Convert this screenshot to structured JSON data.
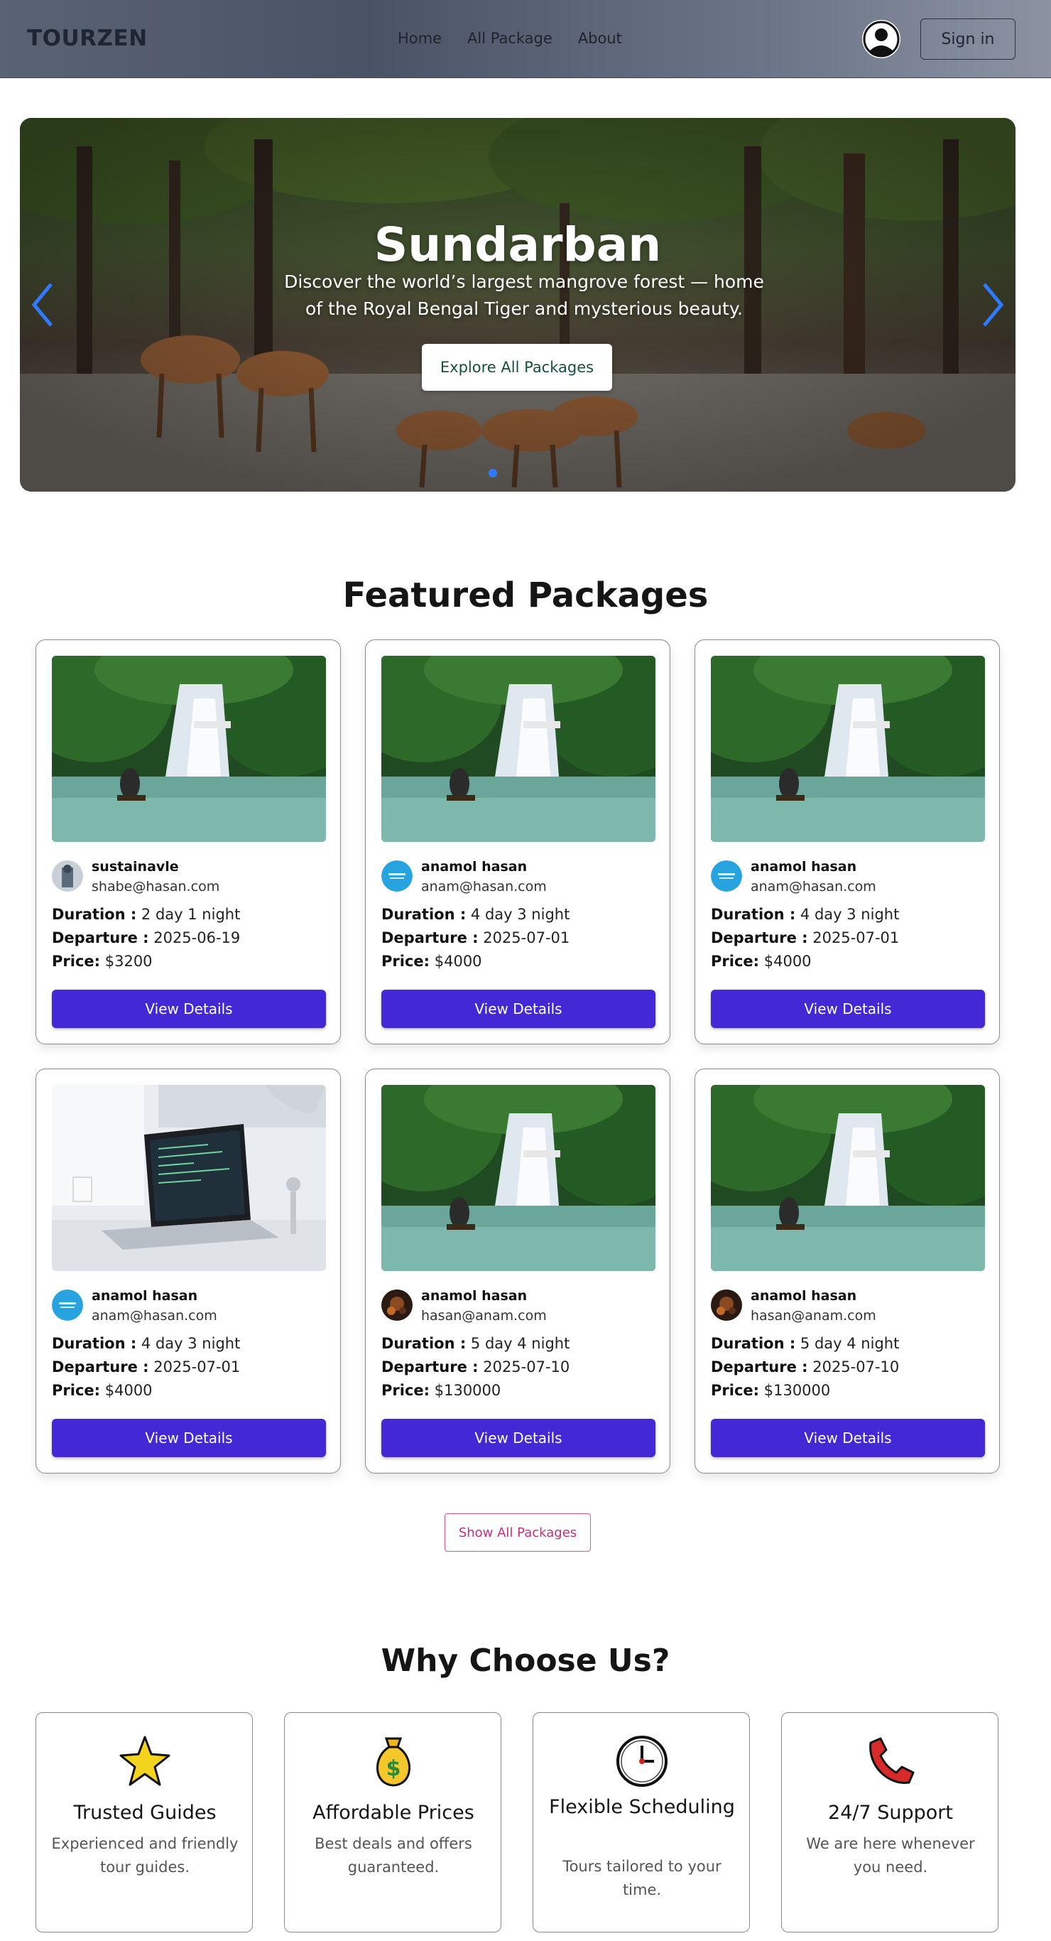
{
  "nav": {
    "brand": "TOURZEN",
    "links": [
      "Home",
      "All Package",
      "About"
    ],
    "signin": "Sign in"
  },
  "hero": {
    "title": "Sundarban",
    "subtitle": "Discover the world’s largest mangrove forest — home of the Royal Bengal Tiger and mysterious beauty.",
    "button": "Explore All Packages"
  },
  "featured": {
    "title": "Featured Packages",
    "cards": [
      {
        "name": "sustainavle",
        "email": "shabe@hasan.com",
        "duration": "2 day 1 night",
        "departure": "2025-06-19",
        "price": "$3200",
        "image": "waterfall",
        "avatar": "photo-grey"
      },
      {
        "name": "anamol hasan",
        "email": "anam@hasan.com",
        "duration": "4 day 3 night",
        "departure": "2025-07-01",
        "price": "$4000",
        "image": "waterfall",
        "avatar": "logo-blue"
      },
      {
        "name": "anamol hasan",
        "email": "anam@hasan.com",
        "duration": "4 day 3 night",
        "departure": "2025-07-01",
        "price": "$4000",
        "image": "waterfall",
        "avatar": "logo-blue"
      },
      {
        "name": "anamol hasan",
        "email": "anam@hasan.com",
        "duration": "4 day 3 night",
        "departure": "2025-07-01",
        "price": "$4000",
        "image": "laptop-desk",
        "avatar": "logo-blue"
      },
      {
        "name": "anamol hasan",
        "email": "hasan@anam.com",
        "duration": "5 day 4 night",
        "departure": "2025-07-10",
        "price": "$130000",
        "image": "waterfall",
        "avatar": "photo-dark"
      },
      {
        "name": "anamol hasan",
        "email": "hasan@anam.com",
        "duration": "5 day 4 night",
        "departure": "2025-07-10",
        "price": "$130000",
        "image": "waterfall",
        "avatar": "photo-dark"
      }
    ],
    "labels": {
      "duration": "Duration :",
      "departure": "Departure :",
      "price": "Price:",
      "view": "View Details"
    },
    "show_all": "Show All Packages"
  },
  "why": {
    "title": "Why Choose Us?",
    "items": [
      {
        "title": "Trusted Guides",
        "desc": "Experienced and friendly tour guides.",
        "icon": "star-icon"
      },
      {
        "title": "Affordable Prices",
        "desc": "Best deals and offers guaranteed.",
        "icon": "money-bag-icon"
      },
      {
        "title": "Flexible Scheduling",
        "desc": "Tours tailored to your time.",
        "icon": "clock-icon"
      },
      {
        "title": "24/7 Support",
        "desc": "We are here whenever you need.",
        "icon": "phone-icon"
      }
    ]
  },
  "colors": {
    "primary_button": "#4328d6",
    "accent_pink": "#c5307a",
    "arrow_blue": "#2f7bff"
  }
}
